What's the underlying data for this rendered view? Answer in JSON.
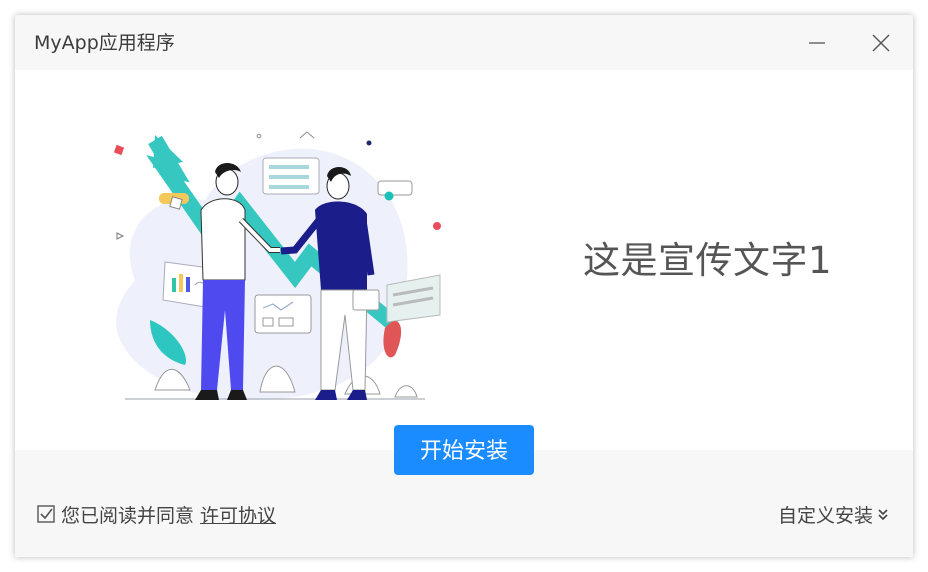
{
  "window": {
    "title": "MyApp应用程序"
  },
  "titlebar": {
    "minimize_icon": "minimize-icon",
    "close_icon": "close-icon"
  },
  "banner": {
    "slogan": "这是宣传文字1",
    "illustration": "business-handshake-illustration"
  },
  "actions": {
    "install_label": "开始安装",
    "agree_text": "您已阅读并同意",
    "license_link": "许可协议",
    "agree_checked": true,
    "custom_install_label": "自定义安装",
    "custom_install_icon": "double-chevron-down-icon"
  },
  "colors": {
    "accent": "#1a8cff",
    "titlebar_bg": "#f7f7f7",
    "footer_bg": "#f7f7f7",
    "text": "#444444",
    "slogan_text": "#555555"
  }
}
